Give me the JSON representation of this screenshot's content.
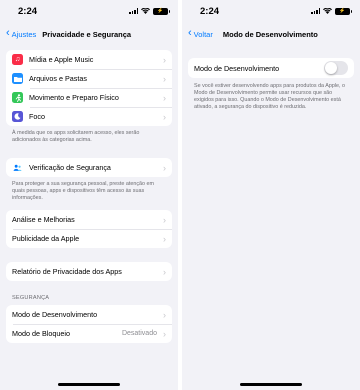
{
  "left": {
    "status": {
      "time": "2:24",
      "battery": "⚡"
    },
    "nav": {
      "back_label": "Ajustes",
      "title": "Privacidade e Segurança"
    },
    "apps_group": [
      {
        "label": "Mídia e Apple Music",
        "icon": "music-note-icon",
        "color": "#fa2d48"
      },
      {
        "label": "Arquivos e Pastas",
        "icon": "folder-icon",
        "color": "#1e90ff"
      },
      {
        "label": "Movimento e Preparo Físico",
        "icon": "fitness-icon",
        "color": "#34c759"
      },
      {
        "label": "Foco",
        "icon": "moon-icon",
        "color": "#5856d6"
      }
    ],
    "apps_footer": "À medida que os apps solicitarem acesso, eles serão adicionados às categorias acima.",
    "safety_check": {
      "label": "Verificação de Segurança",
      "icon": "people-icon",
      "color": "#007aff"
    },
    "safety_footer": "Para proteger a sua segurança pessoal, preste atenção em quais pessoas, apps e dispositivos têm acesso às suas informações.",
    "analytics_group": [
      "Análise e Melhorias",
      "Publicidade da Apple"
    ],
    "report": "Relatório de Privacidade dos Apps",
    "security_header": "SEGURANÇA",
    "security_group": [
      {
        "label": "Modo de Desenvolvimento",
        "value": ""
      },
      {
        "label": "Modo de Bloqueio",
        "value": "Desativado"
      }
    ]
  },
  "right": {
    "status": {
      "time": "2:24",
      "battery": "⚡"
    },
    "nav": {
      "back_label": "Voltar",
      "title": "Modo de Desenvolvimento"
    },
    "toggle_label": "Modo de Desenvolvimento",
    "toggle_on": false,
    "footer": "Se você estiver desenvolvendo apps para produtos da Apple, o Modo de Desenvolvimento permite usar recursos que são exigidos para isso. Quando o Modo de Desenvolvimento está ativado, a segurança do dispositivo é reduzida."
  },
  "colors": {
    "accent": "#007aff",
    "background": "#f2f2f7"
  }
}
